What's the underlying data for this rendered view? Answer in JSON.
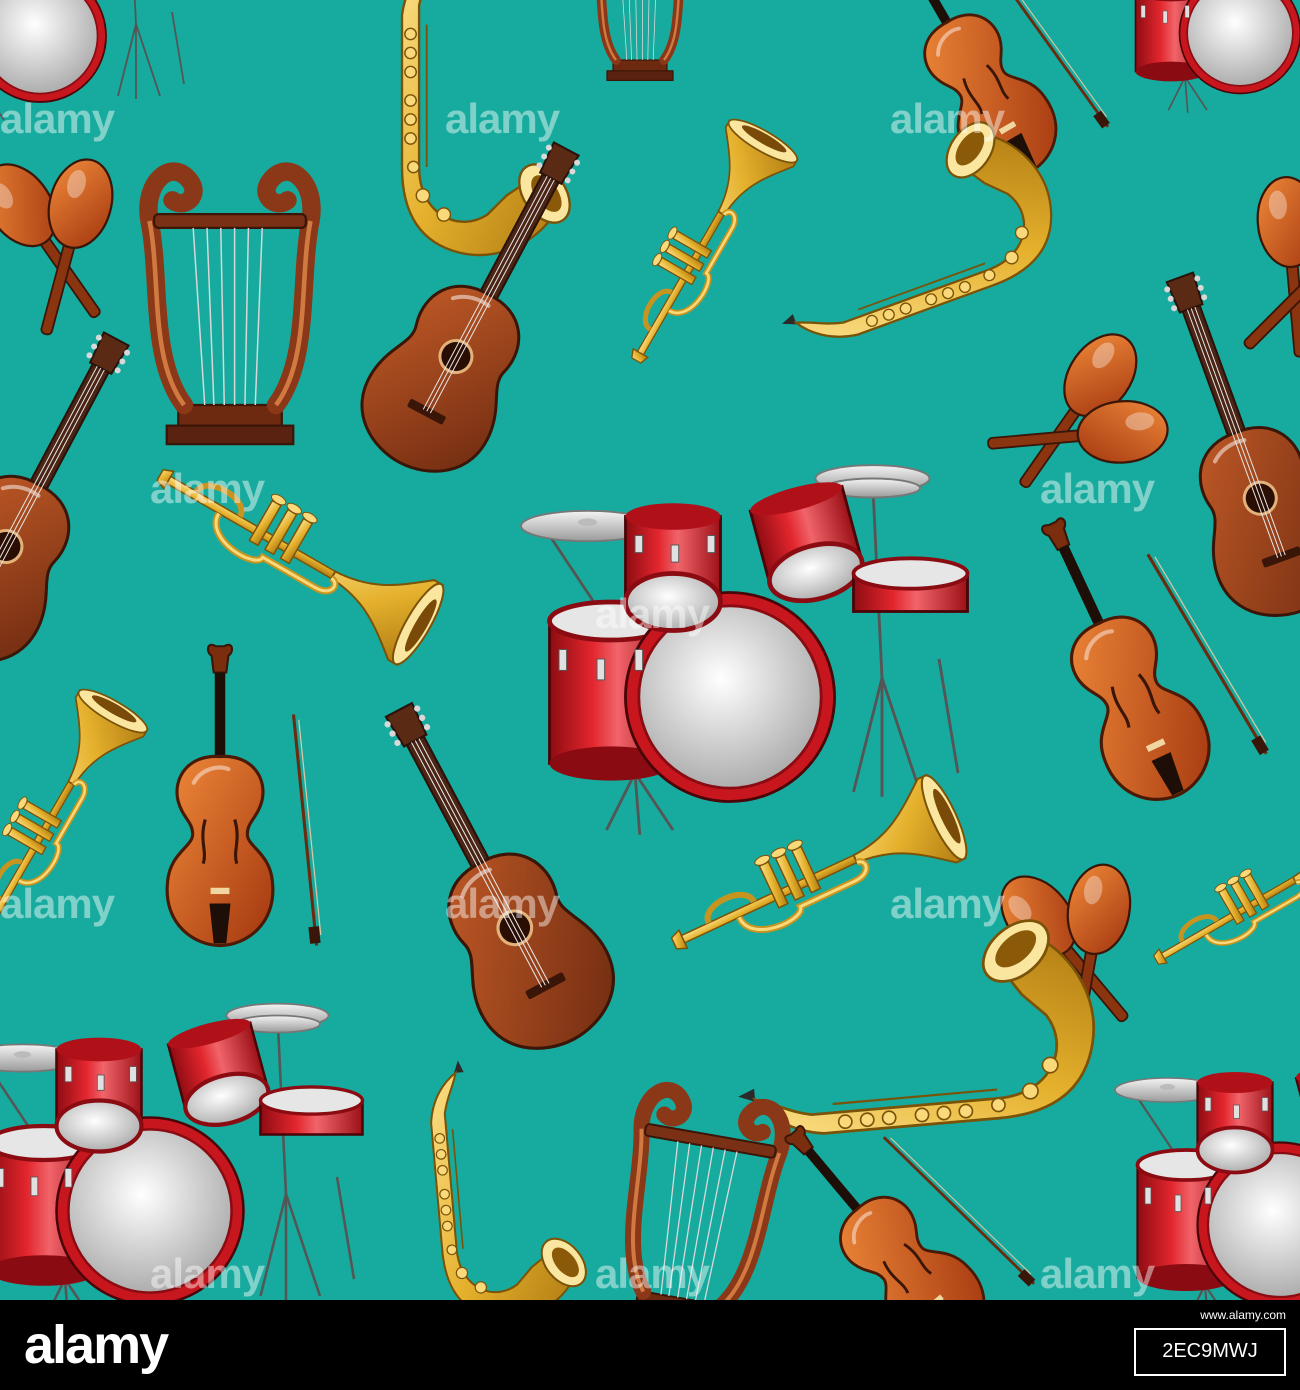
{
  "background_color": "#16ab9e",
  "watermark_text": "alamy",
  "footer": {
    "logo": "alamy",
    "image_id": "2EC9MWJ",
    "label": "www.alamy.com"
  },
  "instruments": [
    {
      "name": "acoustic-guitar"
    },
    {
      "name": "violin"
    },
    {
      "name": "trumpet"
    },
    {
      "name": "saxophone"
    },
    {
      "name": "drum-kit"
    },
    {
      "name": "lyre"
    },
    {
      "name": "maracas"
    }
  ],
  "colors": {
    "wood_dark": "#7a3414",
    "wood_mid": "#b4501e",
    "wood_light": "#d9763a",
    "brass": "#e0aa26",
    "brass_light": "#f7d472",
    "drum_red": "#c8161e",
    "drum_head": "#e8e8e8",
    "outline": "#3a1c10"
  }
}
